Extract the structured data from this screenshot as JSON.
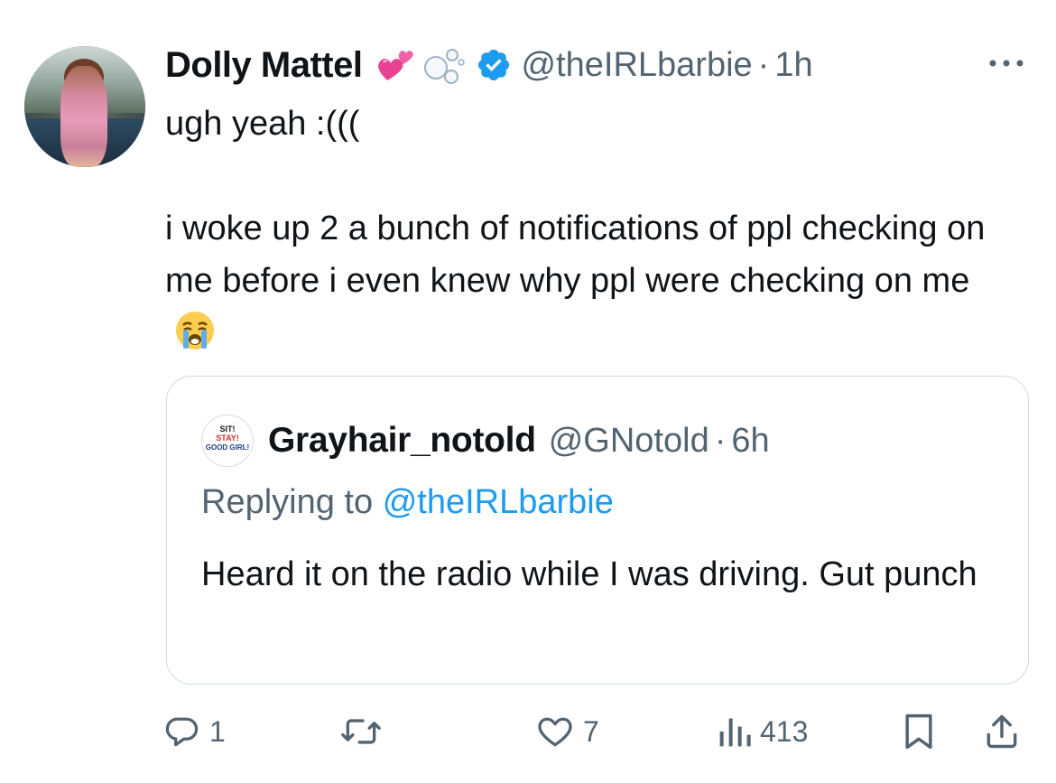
{
  "author": {
    "display_name": "Dolly Mattel",
    "name_emojis": [
      "💞",
      "🫧"
    ],
    "verified": true,
    "handle": "@theIRLbarbie",
    "separator": "·",
    "time": "1h"
  },
  "tweet": {
    "line1": "ugh yeah :(((",
    "line2": "i woke up 2 a bunch of notifications of ppl checking on me before i even knew why ppl were checking on me",
    "trailing_emoji": "😭"
  },
  "quoted": {
    "avatar_text": [
      "SIT!",
      "STAY!",
      "GOOD GIRL!"
    ],
    "display_name": "Grayhair_notold",
    "handle": "@GNotold",
    "separator": "·",
    "time": "6h",
    "replying_prefix": "Replying to",
    "replying_to": "@theIRLbarbie",
    "text": "Heard it on the radio while I was driving. Gut punch"
  },
  "actions": {
    "reply_count": "1",
    "retweet_count": "",
    "like_count": "7",
    "views_count": "413"
  },
  "colors": {
    "text_primary": "#0f1419",
    "text_secondary": "#536471",
    "accent": "#1d9bf0",
    "border": "#cfd9de"
  }
}
